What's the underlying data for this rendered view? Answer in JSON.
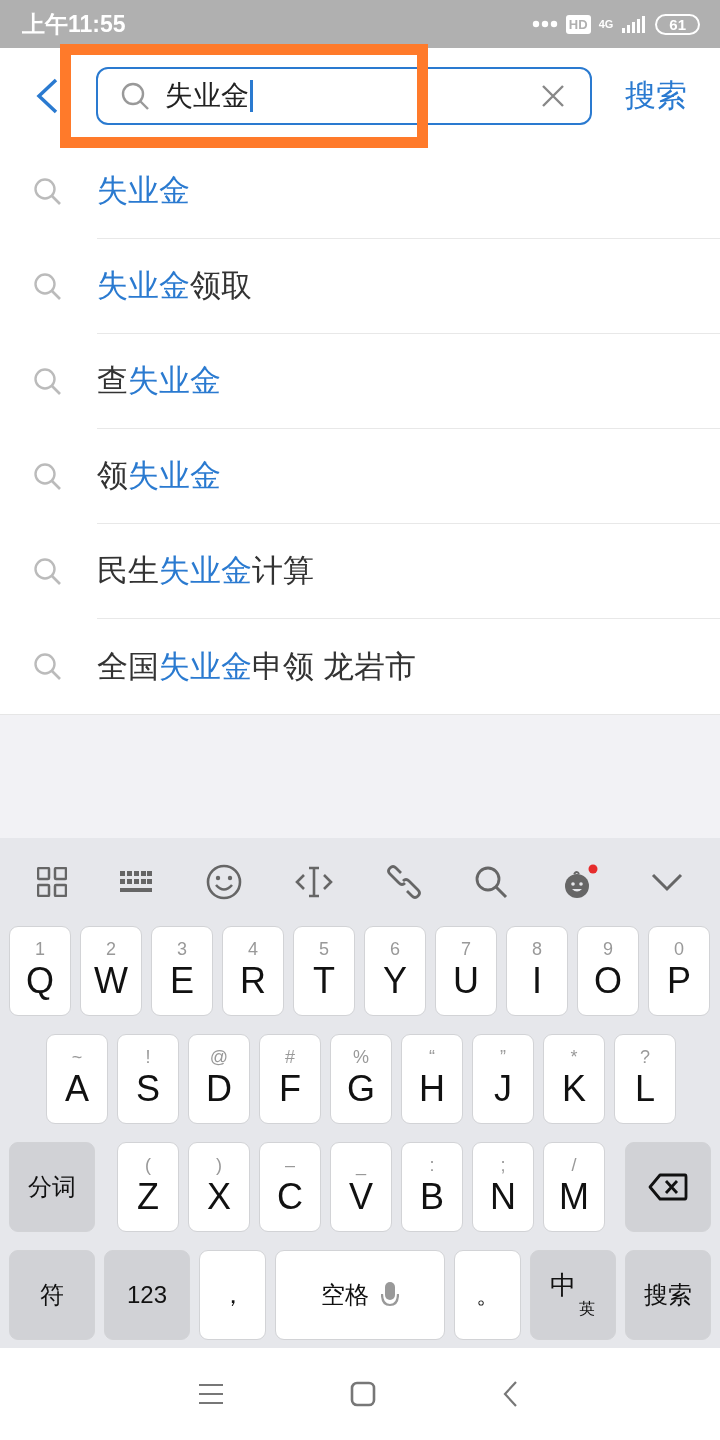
{
  "status_bar": {
    "time": "上午11:55",
    "hd": "HD",
    "network": "4G",
    "battery": "61"
  },
  "search": {
    "value": "失业金",
    "action": "搜索"
  },
  "suggestions": [
    {
      "parts": [
        {
          "text": "失业金",
          "highlight": true
        }
      ]
    },
    {
      "parts": [
        {
          "text": "失业金",
          "highlight": true
        },
        {
          "text": "领取",
          "highlight": false
        }
      ]
    },
    {
      "parts": [
        {
          "text": "查",
          "highlight": false
        },
        {
          "text": "失业金",
          "highlight": true
        }
      ]
    },
    {
      "parts": [
        {
          "text": "领",
          "highlight": false
        },
        {
          "text": "失业金",
          "highlight": true
        }
      ]
    },
    {
      "parts": [
        {
          "text": "民生",
          "highlight": false
        },
        {
          "text": "失业金",
          "highlight": true
        },
        {
          "text": "计算",
          "highlight": false
        }
      ]
    },
    {
      "parts": [
        {
          "text": "全国",
          "highlight": false
        },
        {
          "text": "失业金",
          "highlight": true
        },
        {
          "text": "申领 龙岩市",
          "highlight": false
        }
      ]
    }
  ],
  "keyboard": {
    "rows": [
      {
        "keys": [
          {
            "kind": "letter",
            "label": "Q",
            "hint": "1"
          },
          {
            "kind": "letter",
            "label": "W",
            "hint": "2"
          },
          {
            "kind": "letter",
            "label": "E",
            "hint": "3"
          },
          {
            "kind": "letter",
            "label": "R",
            "hint": "4"
          },
          {
            "kind": "letter",
            "label": "T",
            "hint": "5"
          },
          {
            "kind": "letter",
            "label": "Y",
            "hint": "6"
          },
          {
            "kind": "letter",
            "label": "U",
            "hint": "7"
          },
          {
            "kind": "letter",
            "label": "I",
            "hint": "8"
          },
          {
            "kind": "letter",
            "label": "O",
            "hint": "9"
          },
          {
            "kind": "letter",
            "label": "P",
            "hint": "0"
          }
        ]
      },
      {
        "keys": [
          {
            "kind": "letter",
            "label": "A",
            "hint": "~"
          },
          {
            "kind": "letter",
            "label": "S",
            "hint": "!"
          },
          {
            "kind": "letter",
            "label": "D",
            "hint": "@"
          },
          {
            "kind": "letter",
            "label": "F",
            "hint": "#"
          },
          {
            "kind": "letter",
            "label": "G",
            "hint": "%"
          },
          {
            "kind": "letter",
            "label": "H",
            "hint": "“"
          },
          {
            "kind": "letter",
            "label": "J",
            "hint": "”"
          },
          {
            "kind": "letter",
            "label": "K",
            "hint": "*"
          },
          {
            "kind": "letter",
            "label": "L",
            "hint": "?"
          }
        ]
      },
      {
        "keys": [
          {
            "kind": "function",
            "label": "分词"
          },
          {
            "kind": "letter",
            "label": "Z",
            "hint": "("
          },
          {
            "kind": "letter",
            "label": "X",
            "hint": ")"
          },
          {
            "kind": "letter",
            "label": "C",
            "hint": "–"
          },
          {
            "kind": "letter",
            "label": "V",
            "hint": "_"
          },
          {
            "kind": "letter",
            "label": "B",
            "hint": ":"
          },
          {
            "kind": "letter",
            "label": "N",
            "hint": ";"
          },
          {
            "kind": "letter",
            "label": "M",
            "hint": "/"
          },
          {
            "kind": "backspace"
          }
        ]
      },
      {
        "keys": [
          {
            "kind": "function",
            "label": "符"
          },
          {
            "kind": "function",
            "label": "123"
          },
          {
            "kind": "punct",
            "label": "，"
          },
          {
            "kind": "space",
            "label": "空格"
          },
          {
            "kind": "punct",
            "label": "。"
          },
          {
            "kind": "lang",
            "label": "中",
            "sub": "英"
          },
          {
            "kind": "function",
            "label": "搜索"
          }
        ]
      }
    ]
  }
}
